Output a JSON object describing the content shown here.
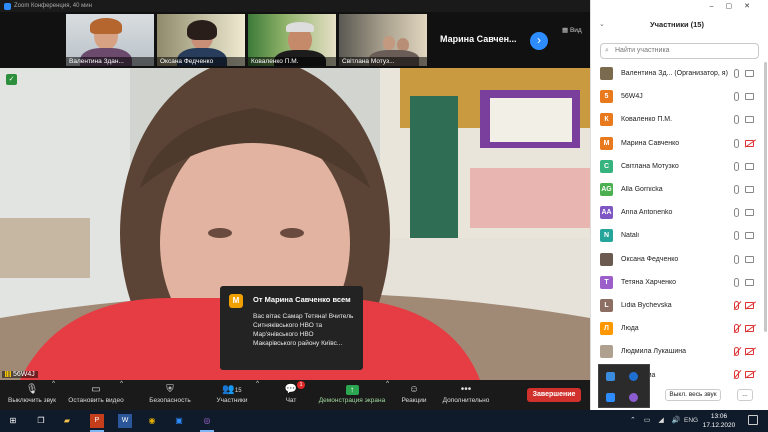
{
  "window": {
    "title": "Zoom Конференция, 40 мин"
  },
  "thumbnails": [
    {
      "name": "Валентина Здан..."
    },
    {
      "name": "Оксана Федченко"
    },
    {
      "name": "Коваленко П.М."
    },
    {
      "name": "Світлана Мотуз..."
    }
  ],
  "strip": {
    "active_name": "Марина Савчен...",
    "view_label": "Вид"
  },
  "video": {
    "speaker_label": "56W4J"
  },
  "chat_popup": {
    "avatar": "М",
    "header": "От Марина Савченко всем",
    "message": "Вас вітає Самар Тетяна! Вчитель Ситняківського НВО та Мар'янівського НВО Макарівського району Київс..."
  },
  "toolbar": {
    "mute": "Выключить звук",
    "stop_video": "Остановить видео",
    "security": "Безопасность",
    "participants": "Участники",
    "participants_count": "15",
    "chat": "Чат",
    "chat_badge": "1",
    "share": "Демонстрация экрана",
    "reactions": "Реакции",
    "more": "Дополнительно",
    "end": "Завершение"
  },
  "panel": {
    "title": "Участники (15)",
    "search_placeholder": "Найти участника",
    "participants": [
      {
        "initial": "",
        "name": "Валентина Зд... (Организатор, я)",
        "color": "#7a6a4e",
        "mic_off": false,
        "cam_off": false
      },
      {
        "initial": "5",
        "name": "56W4J",
        "color": "#e8791d",
        "mic_off": false,
        "cam_off": false
      },
      {
        "initial": "К",
        "name": "Коваленко П.М.",
        "color": "#e8791d",
        "mic_off": false,
        "cam_off": false
      },
      {
        "initial": "М",
        "name": "Марина Савченко",
        "color": "#e8791d",
        "mic_off": false,
        "cam_off": true
      },
      {
        "initial": "С",
        "name": "Світлана Мотузко",
        "color": "#36b37e",
        "mic_off": false,
        "cam_off": false
      },
      {
        "initial": "AG",
        "name": "Alla Gornicka",
        "color": "#4caf50",
        "mic_off": false,
        "cam_off": false
      },
      {
        "initial": "AA",
        "name": "Anna Antonenko",
        "color": "#7e57c2",
        "mic_off": false,
        "cam_off": false
      },
      {
        "initial": "N",
        "name": "Natali",
        "color": "#26a69a",
        "mic_off": false,
        "cam_off": false
      },
      {
        "initial": "",
        "name": "Оксана Федченко",
        "color": "#6b5a50",
        "mic_off": false,
        "cam_off": false
      },
      {
        "initial": "Т",
        "name": "Тетяна Харченко",
        "color": "#9c5fc9",
        "mic_off": false,
        "cam_off": false
      },
      {
        "initial": "L",
        "name": "Lidia Bychevska",
        "color": "#8d6e63",
        "mic_off": true,
        "cam_off": true
      },
      {
        "initial": "Л",
        "name": "Люда",
        "color": "#ff9800",
        "mic_off": true,
        "cam_off": true
      },
      {
        "initial": "",
        "name": "Людмила Лукашина",
        "color": "#b0a090",
        "mic_off": true,
        "cam_off": true
      },
      {
        "initial": "",
        "name": "...а Суліма",
        "color": "#a08070",
        "mic_off": true,
        "cam_off": true
      }
    ],
    "footer": {
      "mute_all": "Выкл. весь звук",
      "more": "..."
    }
  },
  "taskbar": {
    "lang": "ENG",
    "time": "13:06",
    "date": "17.12.2020"
  }
}
